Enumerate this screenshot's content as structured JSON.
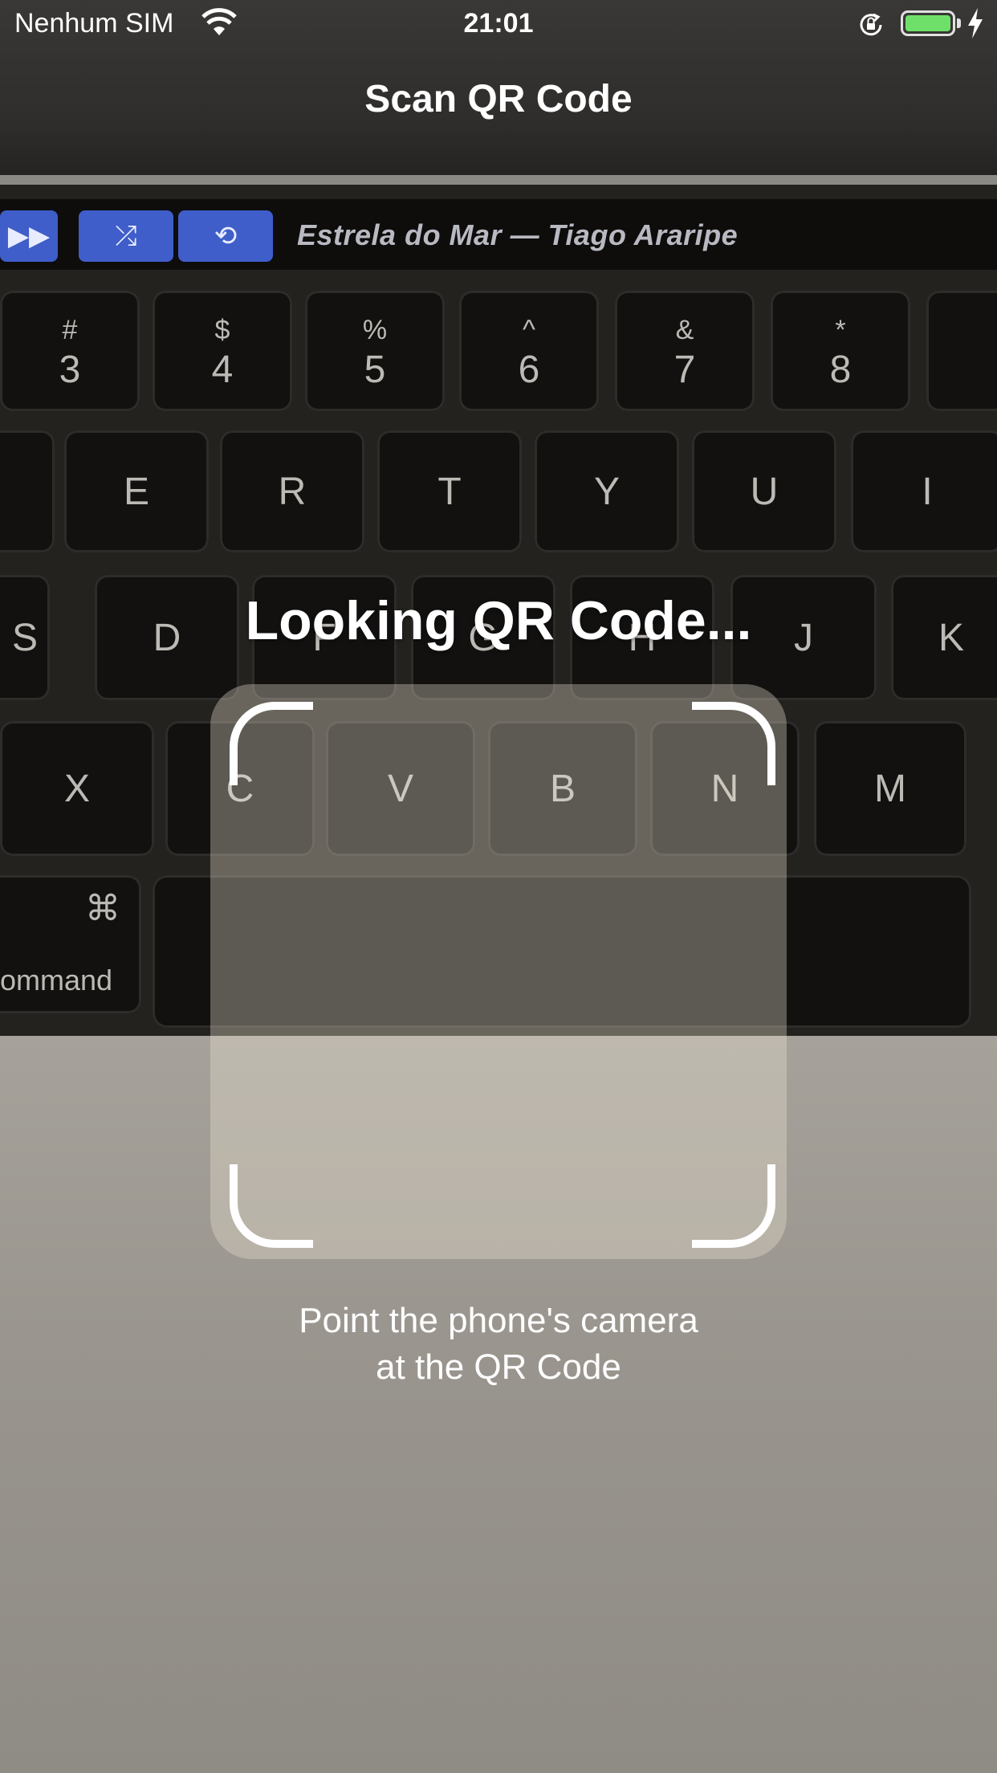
{
  "status_bar": {
    "carrier": "Nenhum SIM",
    "time": "21:01",
    "icons": [
      "wifi-icon",
      "orientation-lock-icon",
      "battery-icon",
      "charging-icon"
    ],
    "battery_color": "#6ee06a"
  },
  "nav": {
    "title": "Scan QR Code"
  },
  "camera_scene": {
    "touch_bar_text": "Estrela do Mar — Tiago Araripe",
    "touch_bar_icons": [
      "fast-forward-icon",
      "shuffle-icon",
      "repeat-icon"
    ],
    "number_keys": [
      {
        "top": "#",
        "bottom": "3"
      },
      {
        "top": "$",
        "bottom": "4"
      },
      {
        "top": "%",
        "bottom": "5"
      },
      {
        "top": "^",
        "bottom": "6"
      },
      {
        "top": "&",
        "bottom": "7"
      },
      {
        "top": "*",
        "bottom": "8"
      }
    ],
    "row_q": [
      "E",
      "R",
      "T",
      "Y",
      "U",
      "I"
    ],
    "row_a": [
      "S",
      "D",
      "F",
      "G",
      "H",
      "J",
      "K"
    ],
    "row_z": [
      "X",
      "C",
      "V",
      "B",
      "N",
      "M"
    ],
    "command_symbol": "⌘",
    "command_label": "ommand"
  },
  "scanner": {
    "status_text": "Looking QR Code...",
    "hint_line1": "Point the phone's camera",
    "hint_line2": "at the QR Code"
  }
}
